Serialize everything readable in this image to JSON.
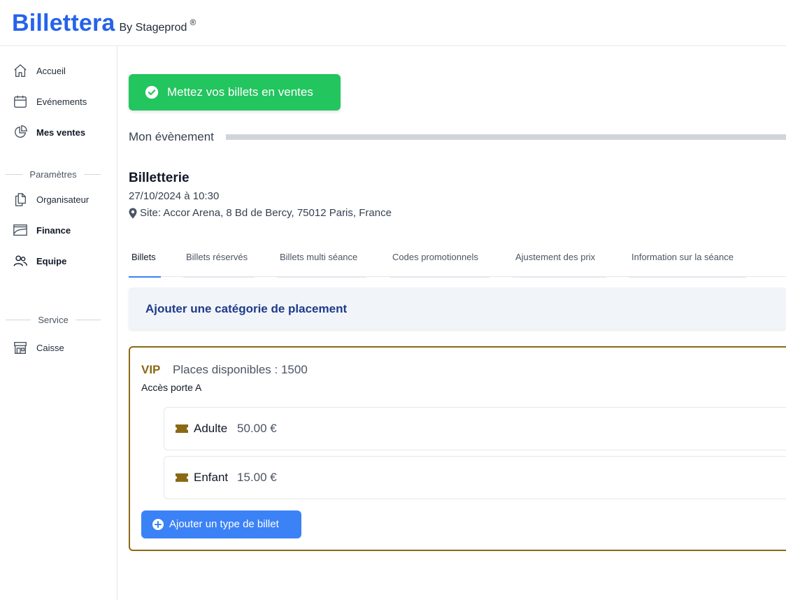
{
  "brand": {
    "name": "Billettera",
    "sub": "By Stageprod",
    "reg": "®"
  },
  "sidebar": {
    "items": [
      {
        "label": "Accueil",
        "icon": "home-icon"
      },
      {
        "label": "Evénements",
        "icon": "calendar-icon"
      },
      {
        "label": "Mes ventes",
        "icon": "pie-chart-icon"
      }
    ],
    "section_params": "Paramètres",
    "params_items": [
      {
        "label": "Organisateur",
        "icon": "documents-icon"
      },
      {
        "label": "Finance",
        "icon": "finance-icon"
      },
      {
        "label": "Equipe",
        "icon": "users-icon"
      }
    ],
    "section_service": "Service",
    "service_items": [
      {
        "label": "Caisse",
        "icon": "store-icon"
      }
    ]
  },
  "main": {
    "sell_button": "Mettez vos billets en ventes",
    "event_heading": "Mon évènement",
    "event": {
      "name": "Billetterie",
      "date": "27/10/2024 à 10:30",
      "site": "Site: Accor Arena, 8 Bd de Bercy, 75012 Paris, France"
    },
    "tabs": [
      {
        "label": "Billets"
      },
      {
        "label": "Billets réservés"
      },
      {
        "label": "Billets multi séance"
      },
      {
        "label": "Codes promotionnels"
      },
      {
        "label": "Ajustement des prix"
      },
      {
        "label": "Information sur la séance"
      }
    ],
    "add_category": "Ajouter une catégorie de placement",
    "category": {
      "name": "VIP",
      "places": "Places disponibles : 1500",
      "description": "Accès porte A",
      "tickets": [
        {
          "name": "Adulte",
          "price": "50.00 €"
        },
        {
          "name": "Enfant",
          "price": "15.00 €"
        }
      ],
      "add_type": "Ajouter un type de billet"
    }
  },
  "colors": {
    "brand": "#2563eb",
    "success": "#22c55e",
    "primary": "#3b82f6",
    "category_border": "#8b6914"
  }
}
